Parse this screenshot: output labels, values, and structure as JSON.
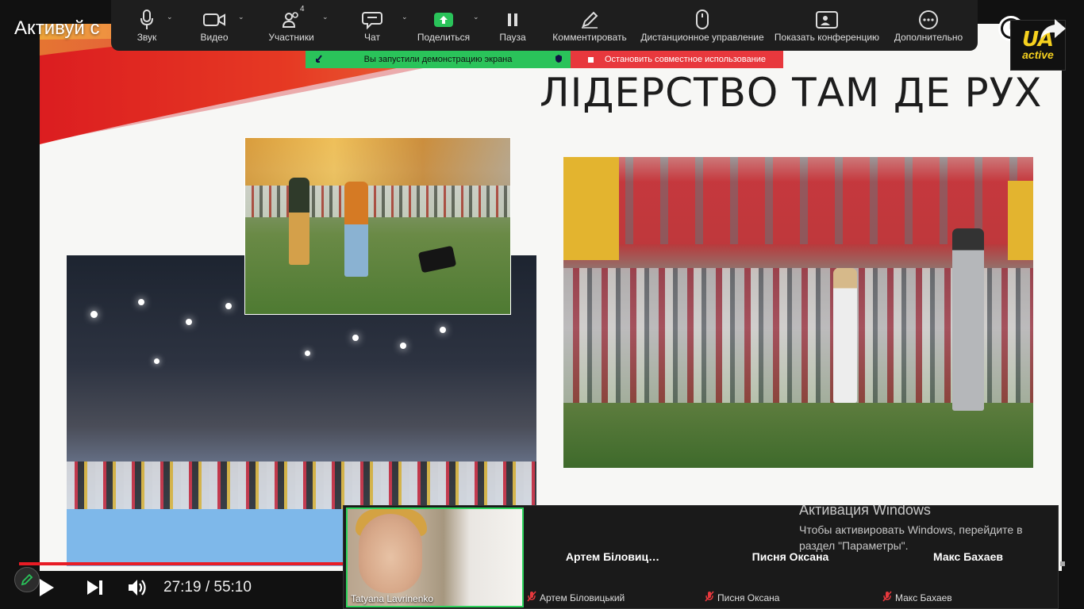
{
  "video": {
    "title": "Активуй с",
    "time": "27:19 / 55:10",
    "progress": 0.495
  },
  "toolbar": {
    "buttons": [
      {
        "label": "Звук",
        "icon": "microphone-icon"
      },
      {
        "label": "Видео",
        "icon": "video-camera-icon"
      },
      {
        "label": "Участники",
        "icon": "participants-icon",
        "badge": "4"
      },
      {
        "label": "Чат",
        "icon": "chat-icon"
      },
      {
        "label": "Поделиться",
        "icon": "share-screen-icon"
      },
      {
        "label": "Пауза",
        "icon": "pause-icon"
      },
      {
        "label": "Комментировать",
        "icon": "pen-icon"
      },
      {
        "label": "Дистанционное управление",
        "icon": "mouse-icon"
      },
      {
        "label": "Показать конференцию",
        "icon": "show-conference-icon"
      },
      {
        "label": "Дополнительно",
        "icon": "more-icon"
      }
    ]
  },
  "share_banner": {
    "status": "Вы запустили демонстрацию экрана",
    "stop": "Остановить совместное использование"
  },
  "slide": {
    "title": "ЛІДЕРСТВО ТАМ ДЕ РУХ"
  },
  "logo": {
    "line1": "UA",
    "line2": "active"
  },
  "participants": {
    "self_name": "Tatyana Lavrinenko",
    "others": [
      {
        "display": "Артем Біловиц…",
        "name": "Артем Біловицький"
      },
      {
        "display": "Писня Оксана",
        "name": "Писня Оксана"
      },
      {
        "display": "Макс Бахаев",
        "name": "Макс Бахаев"
      }
    ]
  },
  "windows_activation": {
    "title": "Активация Windows",
    "line1": "Чтобы активировать Windows, перейдите в",
    "line2": "раздел \"Параметры\"."
  },
  "colors": {
    "toolbar_bg": "#1e1e1e",
    "share_green": "#2ac35a",
    "share_red": "#e8383d",
    "progress_red": "#e81c25",
    "logo_yellow": "#f6d11f"
  }
}
